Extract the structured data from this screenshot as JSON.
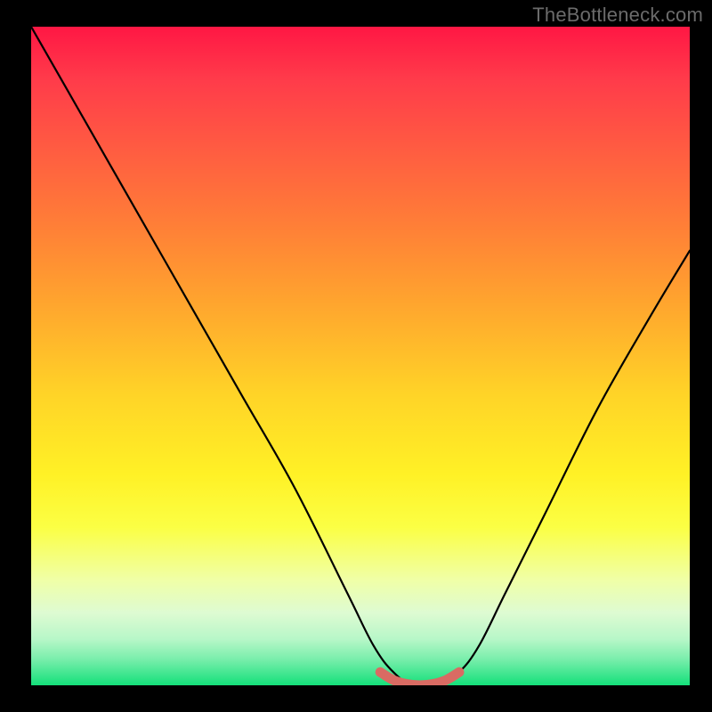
{
  "watermark": "TheBottleneck.com",
  "chart_data": {
    "type": "line",
    "title": "",
    "xlabel": "",
    "ylabel": "",
    "xlim": [
      0,
      100
    ],
    "ylim": [
      0,
      100
    ],
    "grid": false,
    "legend": "none",
    "series": [
      {
        "name": "bottleneck-curve",
        "x": [
          0,
          8,
          16,
          24,
          32,
          40,
          48,
          52,
          55,
          58,
          62,
          65,
          68,
          72,
          78,
          86,
          94,
          100
        ],
        "y": [
          100,
          86,
          72,
          58,
          44,
          30,
          14,
          6,
          2,
          0,
          0,
          2,
          6,
          14,
          26,
          42,
          56,
          66
        ]
      },
      {
        "name": "bottom-highlight",
        "x": [
          53,
          55,
          57,
          59,
          61,
          63,
          65
        ],
        "y": [
          2,
          0.8,
          0.2,
          0,
          0.2,
          0.8,
          2
        ]
      }
    ],
    "annotations": []
  }
}
